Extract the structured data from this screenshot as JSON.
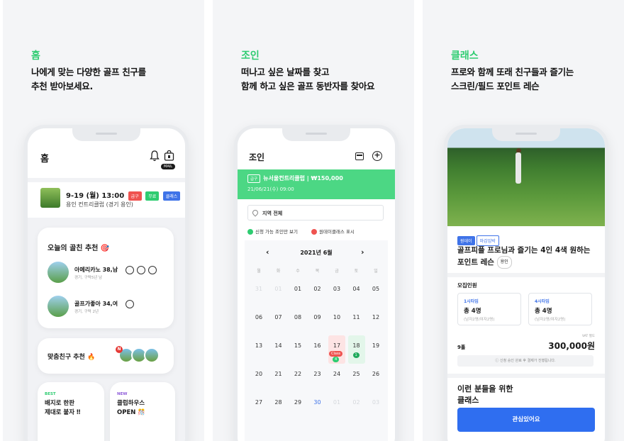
{
  "panels": {
    "home": {
      "category": "홈",
      "subtitle": "나에게 맞는 다양한 골프 친구를\n추천 받아보세요.",
      "screen": {
        "title": "홈",
        "mail_badge": "MAIL",
        "round": {
          "time": "9-19 (월) 13:00",
          "tags": [
            "급구",
            "무료",
            "클래스"
          ],
          "place": "용인 컨트리클럽 (경기 용인)"
        },
        "recommend_title": "오늘의 골친 추천 🎯",
        "friends": [
          {
            "name": "아메리카노 38,남",
            "desc": "경기, 구력5년 남"
          },
          {
            "name": "골프가좋아 34,여",
            "desc": "경기, 구력 2년"
          }
        ],
        "match_title": "맞춤친구 추천 🔥",
        "match_badge": "N",
        "best": {
          "label": "BEST",
          "text": "배지로 한판\n제대로 붙자 ‼"
        },
        "new": {
          "label": "NEW",
          "text": "클럽하우스\nOPEN 🎊"
        }
      }
    },
    "join": {
      "category": "조인",
      "subtitle": "떠나고 싶은 날짜를 찾고\n함께 하고 싶은 골프 동반자를 찾아요",
      "screen": {
        "title": "조인",
        "banner_pill": "급구",
        "banner_title": "뉴서울컨트리클럽 | ₩150,000",
        "banner_date": "21/06/21(수) 09:00",
        "region": "지역 전체",
        "option1": "신청 가능 조인만 보기",
        "option2": "원데이클래스 표시",
        "month": "2021년 6월",
        "prev": "‹",
        "next": "›",
        "weekdays": [
          "월",
          "화",
          "수",
          "목",
          "금",
          "토",
          "일"
        ],
        "weeks": [
          [
            "31",
            "01",
            "01",
            "02",
            "03",
            "04",
            "05"
          ],
          [
            "06",
            "07",
            "08",
            "09",
            "10",
            "11",
            "12"
          ],
          [
            "13",
            "14",
            "15",
            "16",
            "17",
            "18",
            "19"
          ],
          [
            "20",
            "21",
            "22",
            "23",
            "24",
            "25",
            "26"
          ],
          [
            "27",
            "28",
            "29",
            "30",
            "01",
            "02",
            "03"
          ]
        ],
        "class_chip": "Class",
        "count_chip_17": "4",
        "count_chip_18": "1"
      }
    },
    "class": {
      "category": "클래스",
      "subtitle": "프로와 함께 또래 친구들과 즐기는\n스크린/필드 포인트 레슨",
      "screen": {
        "tags": [
          "원데이",
          "마감임박"
        ],
        "title": "골프피플 프로님과 즐기는 4인 4색 원하는 포인트 레슨",
        "pro_pill": "용인",
        "recruit_label": "모집인원",
        "slots": [
          {
            "label": "1시타임",
            "count": "총 4명",
            "detail": "(남자2명/여자2명)"
          },
          {
            "label": "4시타임",
            "count": "총 4명",
            "detail": "(남자2명/여자2명)"
          }
        ],
        "holes": "9홀",
        "vat": "VAT 별도",
        "price": "300,000원",
        "notice": "ⓘ 신청 승인 완료 후 결제가 진행됩니다.",
        "for_title": "이런 분들을 위한\n클래스",
        "cta": "관심있어요"
      }
    }
  },
  "colors": {
    "green": "#2ecc71",
    "banner": "#4cd784",
    "blue": "#2f6ef0",
    "red": "#ef5350"
  }
}
